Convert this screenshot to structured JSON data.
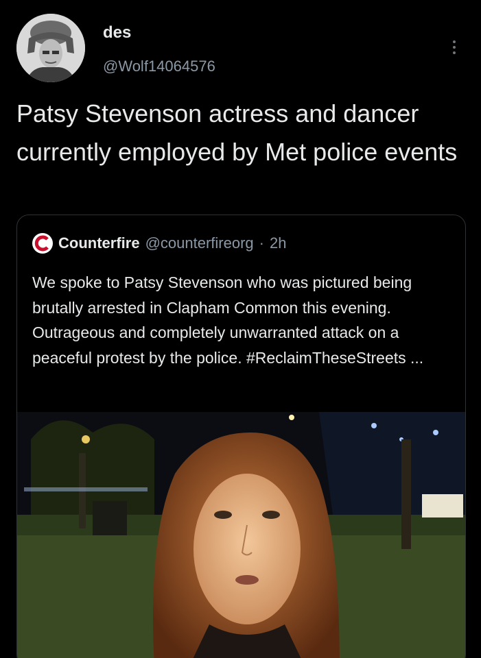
{
  "author": {
    "display_name": "des",
    "handle": "@Wolf14064576",
    "avatar_icon": "user-avatar-photo"
  },
  "tweet": {
    "text": "Patsy Stevenson actress and dancer currently employed by Met police events",
    "more_icon": "more-vertical-icon"
  },
  "quoted_tweet": {
    "logo_icon": "counterfire-logo-icon",
    "name": "Counterfire",
    "handle": "@counterfireorg",
    "separator": "·",
    "time": "2h",
    "text": "We spoke to Patsy Stevenson who was pictured being brutally arrested in Clapham Common this evening. Outrageous and completely unwarranted attack on a peaceful protest by the police. #ReclaimTheseStreets ...",
    "media_icon": "video-thumbnail-photo"
  },
  "colors": {
    "background": "#000000",
    "primary_text": "#e7e9ea",
    "secondary_text": "#8b98a5",
    "card_border": "#2f3336"
  }
}
